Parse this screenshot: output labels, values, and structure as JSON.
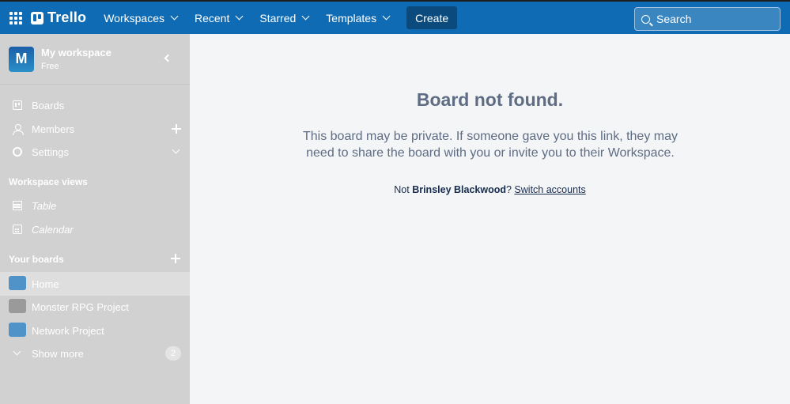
{
  "header": {
    "logo_text": "Trello",
    "nav": [
      {
        "label": "Workspaces"
      },
      {
        "label": "Recent"
      },
      {
        "label": "Starred"
      },
      {
        "label": "Templates"
      }
    ],
    "create_label": "Create",
    "search_placeholder": "Search"
  },
  "sidebar": {
    "workspace": {
      "initial": "M",
      "name": "My workspace",
      "plan": "Free"
    },
    "items": [
      {
        "label": "Boards"
      },
      {
        "label": "Members"
      },
      {
        "label": "Settings"
      }
    ],
    "views_title": "Workspace views",
    "views": [
      {
        "label": "Table"
      },
      {
        "label": "Calendar"
      }
    ],
    "boards_title": "Your boards",
    "boards": [
      {
        "label": "Home",
        "color": "#4f93c9"
      },
      {
        "label": "Monster RPG Project",
        "color": "#9a9a9a"
      },
      {
        "label": "Network Project",
        "color": "#4f93c9"
      }
    ],
    "show_more": {
      "label": "Show more",
      "count": "2"
    }
  },
  "main": {
    "title": "Board not found.",
    "description": "This board may be private. If someone gave you this link, they may need to share the board with you or invite you to their Workspace.",
    "not_prefix": "Not ",
    "user_name": "Brinsley Blackwood",
    "question_mark": "?",
    "switch_label": "Switch accounts"
  },
  "colors": {
    "header_bg": "#0f6cb4",
    "sidebar_bg": "#d1d1d1",
    "main_bg": "#f4f5f7",
    "title_text": "#5e6c84"
  }
}
